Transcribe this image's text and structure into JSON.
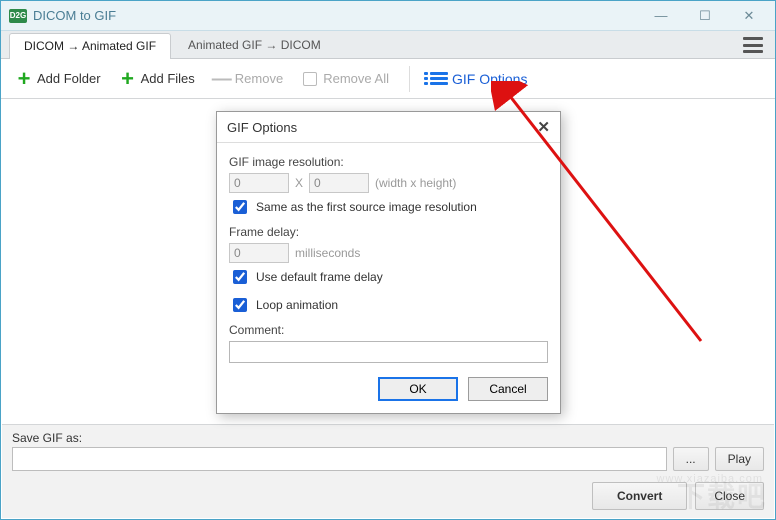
{
  "window": {
    "title": "DICOM to GIF",
    "icon_text": "D2G"
  },
  "tabs": [
    {
      "label": "DICOM  →  Animated GIF",
      "active": true
    },
    {
      "label": "Animated GIF  →  DICOM",
      "active": false
    }
  ],
  "toolbar": {
    "add_folder": "Add Folder",
    "add_files": "Add Files",
    "remove": "Remove",
    "remove_all": "Remove All",
    "gif_options": "GIF Options"
  },
  "dialog": {
    "title": "GIF Options",
    "resolution_label": "GIF image resolution:",
    "width_value": "0",
    "x": "X",
    "height_value": "0",
    "resolution_hint": "(width x height)",
    "same_resolution": "Same as the first source image resolution",
    "same_resolution_checked": true,
    "frame_delay_label": "Frame delay:",
    "frame_delay_value": "0",
    "frame_delay_unit": "milliseconds",
    "use_default_delay": "Use default frame delay",
    "use_default_delay_checked": true,
    "loop_animation": "Loop animation",
    "loop_animation_checked": true,
    "comment_label": "Comment:",
    "comment_value": "",
    "ok": "OK",
    "cancel": "Cancel"
  },
  "bottom": {
    "save_label": "Save GIF as:",
    "path_value": "",
    "browse": "...",
    "play": "Play",
    "convert": "Convert",
    "close": "Close"
  },
  "watermark": {
    "main": "下载吧",
    "url": "www.xiazaiba.com"
  }
}
